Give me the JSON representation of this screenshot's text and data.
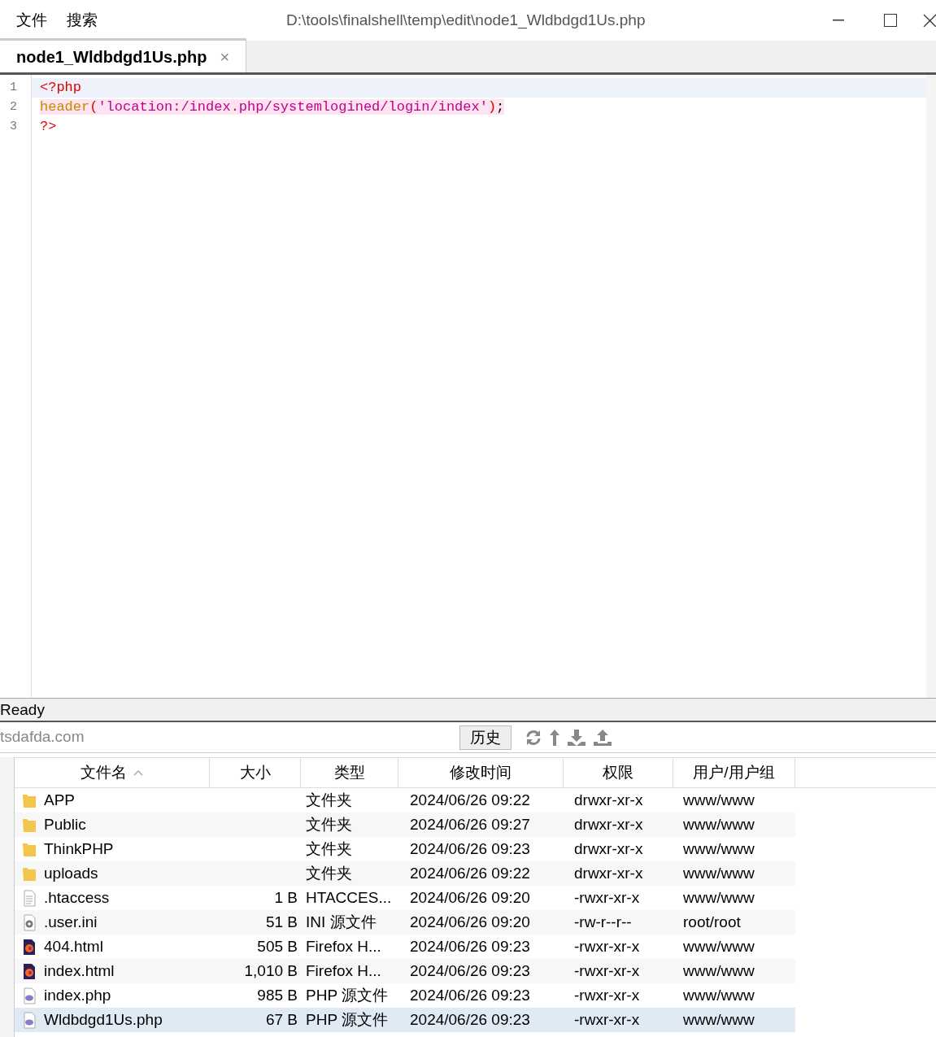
{
  "menu": [
    "文件",
    "搜索"
  ],
  "window": {
    "title": "D:\\tools\\finalshell\\temp\\edit\\node1_Wldbdgd1Us.php"
  },
  "tabs": [
    {
      "label": "node1_Wldbdgd1Us.php",
      "selected": true,
      "close": "×"
    }
  ],
  "editor": {
    "lines": [
      {
        "number": "1",
        "current": true,
        "marked": false,
        "tokens": [
          {
            "kind": "tag",
            "text": "<?php"
          }
        ]
      },
      {
        "number": "2",
        "current": false,
        "marked": true,
        "tokens": [
          {
            "kind": "function",
            "text": "header"
          },
          {
            "kind": "tag",
            "text": "("
          },
          {
            "kind": "string",
            "text": "'location:/index.php/systemlogined/login/index'"
          },
          {
            "kind": "tag",
            "text": ")"
          },
          {
            "kind": "plain",
            "text": ";"
          }
        ]
      },
      {
        "number": "3",
        "current": false,
        "marked": false,
        "tokens": [
          {
            "kind": "tag",
            "text": "?>"
          }
        ]
      }
    ]
  },
  "status_bar": "Ready",
  "file_panel": {
    "path": "tsdafda.com",
    "history_button": "历史",
    "columns": [
      "文件名",
      "大小",
      "类型",
      "修改时间",
      "权限",
      "用户/用户组"
    ],
    "rows": [
      {
        "kind": "folder",
        "name": "APP",
        "size": "",
        "type": "文件夹",
        "modified": "2024/06/26 09:22",
        "permissions": "drwxr-xr-x",
        "owner": "www/www",
        "selected": false
      },
      {
        "kind": "folder",
        "name": "Public",
        "size": "",
        "type": "文件夹",
        "modified": "2024/06/26 09:27",
        "permissions": "drwxr-xr-x",
        "owner": "www/www",
        "selected": false
      },
      {
        "kind": "folder",
        "name": "ThinkPHP",
        "size": "",
        "type": "文件夹",
        "modified": "2024/06/26 09:23",
        "permissions": "drwxr-xr-x",
        "owner": "www/www",
        "selected": false
      },
      {
        "kind": "folder",
        "name": "uploads",
        "size": "",
        "type": "文件夹",
        "modified": "2024/06/26 09:22",
        "permissions": "drwxr-xr-x",
        "owner": "www/www",
        "selected": false
      },
      {
        "kind": "text",
        "name": ".htaccess",
        "size": "1 B",
        "type": "HTACCES...",
        "modified": "2024/06/26 09:20",
        "permissions": "-rwxr-xr-x",
        "owner": "www/www",
        "selected": false
      },
      {
        "kind": "settings",
        "name": ".user.ini",
        "size": "51 B",
        "type": "INI 源文件",
        "modified": "2024/06/26 09:20",
        "permissions": "-rw-r--r--",
        "owner": "root/root",
        "selected": false
      },
      {
        "kind": "firefox",
        "name": "404.html",
        "size": "505 B",
        "type": "Firefox H...",
        "modified": "2024/06/26 09:23",
        "permissions": "-rwxr-xr-x",
        "owner": "www/www",
        "selected": false
      },
      {
        "kind": "firefox",
        "name": "index.html",
        "size": "1,010 B",
        "type": "Firefox H...",
        "modified": "2024/06/26 09:23",
        "permissions": "-rwxr-xr-x",
        "owner": "www/www",
        "selected": false
      },
      {
        "kind": "php",
        "name": "index.php",
        "size": "985 B",
        "type": "PHP 源文件",
        "modified": "2024/06/26 09:23",
        "permissions": "-rwxr-xr-x",
        "owner": "www/www",
        "selected": false
      },
      {
        "kind": "php",
        "name": "Wldbdgd1Us.php",
        "size": "67 B",
        "type": "PHP 源文件",
        "modified": "2024/06/26 09:23",
        "permissions": "-rwxr-xr-x",
        "owner": "www/www",
        "selected": true
      }
    ]
  }
}
